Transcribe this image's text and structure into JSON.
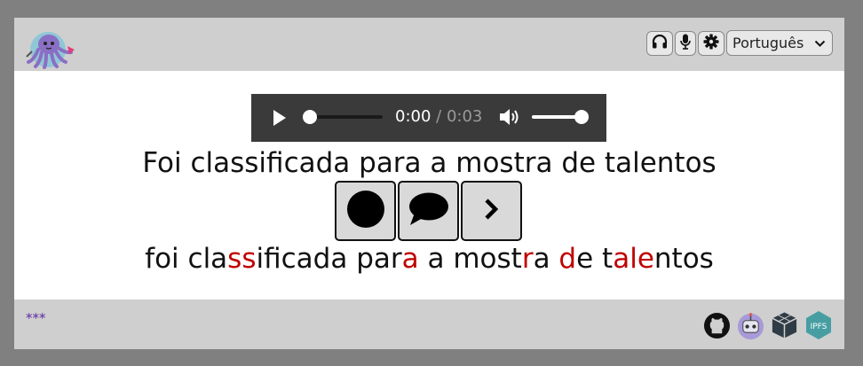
{
  "header": {
    "logo_icon": "octopus-mascot-icon",
    "controls": {
      "listen_icon": "headphones-icon",
      "record_icon": "microphone-icon",
      "settings_icon": "gear-icon",
      "language": "Português"
    }
  },
  "audio": {
    "current_time": "0:00",
    "duration": "/ 0:03",
    "progress": 0.0,
    "volume": 1.0
  },
  "sentence_target": "Foi classificada para a mostra de talentos",
  "sentence_recognized": [
    {
      "text": "foi cla",
      "error": false
    },
    {
      "text": "ss",
      "error": true
    },
    {
      "text": "ificada par",
      "error": false
    },
    {
      "text": "a",
      "error": true
    },
    {
      "text": " a most",
      "error": false
    },
    {
      "text": "r",
      "error": true
    },
    {
      "text": "a ",
      "error": false
    },
    {
      "text": "d",
      "error": true
    },
    {
      "text": "e t",
      "error": false
    },
    {
      "text": "ale",
      "error": true
    },
    {
      "text": "ntos",
      "error": false
    }
  ],
  "actions": [
    {
      "name": "record-button",
      "icon": "record-circle-icon"
    },
    {
      "name": "speech-bubble-button",
      "icon": "speech-bubble-icon"
    },
    {
      "name": "next-button",
      "icon": "chevron-right-icon"
    }
  ],
  "footer": {
    "rating": "***",
    "links": [
      "github-icon",
      "robot-icon",
      "cube-icon",
      "ipfs-icon"
    ],
    "ipfs_label": "IPFS"
  },
  "colors": {
    "error": "#c00000",
    "rating": "#5b2aa3"
  }
}
